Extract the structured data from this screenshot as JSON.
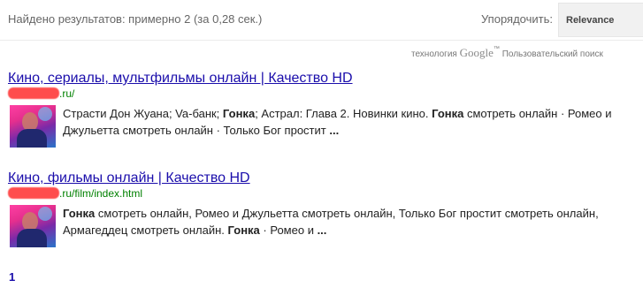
{
  "header": {
    "result_count": "Найдено результатов: примерно 2 (за 0,28 сек.)",
    "sort_label": "Упорядочить:",
    "sort_value": "Relevance"
  },
  "branding": {
    "prefix": "технология",
    "brand": "Google",
    "tm": "™",
    "suffix": "Пользовательский поиск"
  },
  "results": [
    {
      "title": "Кино, сериалы, мультфильмы онлайн | Качество HD",
      "url_suffix": ".ru/",
      "snippet": [
        {
          "t": "Страсти Дон Жуана; Va-банк; ",
          "b": false
        },
        {
          "t": "Гонка",
          "b": true
        },
        {
          "t": "; Астрал: Глава 2. Новинки кино. ",
          "b": false
        },
        {
          "t": "Гонка",
          "b": true
        },
        {
          "t": " смотреть онлайн · Ромео и Джульетта смотреть онлайн · Только Бог простит ",
          "b": false
        },
        {
          "t": "...",
          "b": true
        }
      ]
    },
    {
      "title": "Кино, фильмы онлайн | Качество HD",
      "url_suffix": ".ru/film/index.html",
      "snippet": [
        {
          "t": "Гонка",
          "b": true
        },
        {
          "t": " смотреть онлайн, Ромео и Джульетта смотреть онлайн, Только Бог простит смотреть онлайн, Армагеддец смотреть онлайн. ",
          "b": false
        },
        {
          "t": "Гонка",
          "b": true
        },
        {
          "t": " · Ромео и ",
          "b": false
        },
        {
          "t": "...",
          "b": true
        }
      ]
    }
  ],
  "pagination": {
    "current_page": "1"
  },
  "colors": {
    "link": "#1a0dab",
    "url": "#008000",
    "redaction": "#ff4d4d"
  }
}
